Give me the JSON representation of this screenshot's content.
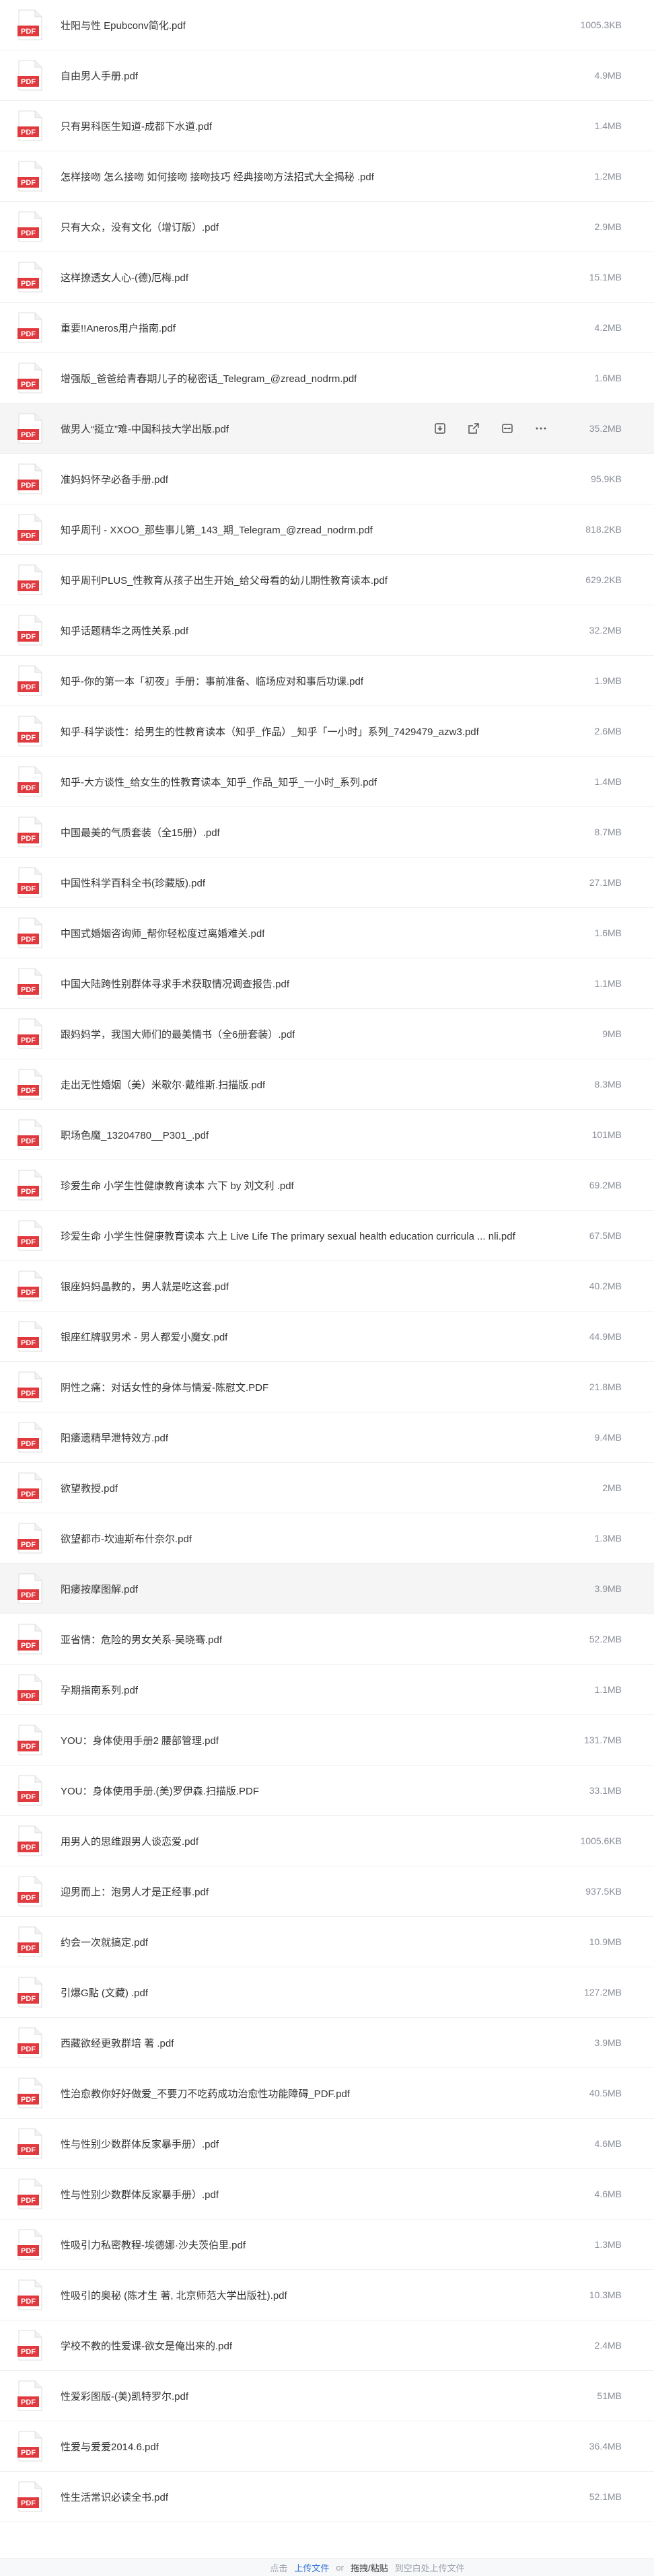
{
  "files": [
    {
      "name": "壮阳与性 Epubconv简化.pdf",
      "size": "1005.3KB"
    },
    {
      "name": "自由男人手册.pdf",
      "size": "4.9MB"
    },
    {
      "name": "只有男科医生知道-成都下水道.pdf",
      "size": "1.4MB"
    },
    {
      "name": "怎样接吻 怎么接吻 如何接吻 接吻技巧 经典接吻方法招式大全揭秘 .pdf",
      "size": "1.2MB"
    },
    {
      "name": "只有大众，没有文化（增订版）.pdf",
      "size": "2.9MB"
    },
    {
      "name": "这样撩透女人心-(德)厄梅.pdf",
      "size": "15.1MB"
    },
    {
      "name": "重要!!Aneros用户指南.pdf",
      "size": "4.2MB"
    },
    {
      "name": "增强版_爸爸给青春期儿子的秘密话_Telegram_@zread_nodrm.pdf",
      "size": "1.6MB"
    },
    {
      "name": "做男人“挺立”难-中国科技大学出版.pdf",
      "size": "35.2MB",
      "hover": true
    },
    {
      "name": "准妈妈怀孕必备手册.pdf",
      "size": "95.9KB"
    },
    {
      "name": "知乎周刊 - XXOO_那些事儿第_143_期_Telegram_@zread_nodrm.pdf",
      "size": "818.2KB"
    },
    {
      "name": "知乎周刊PLUS_性教育从孩子出生开始_给父母看的幼儿期性教育读本.pdf",
      "size": "629.2KB"
    },
    {
      "name": "知乎话题精华之两性关系.pdf",
      "size": "32.2MB"
    },
    {
      "name": "知乎-你的第一本「初夜」手册：事前准备、临场应对和事后功课.pdf",
      "size": "1.9MB"
    },
    {
      "name": "知乎-科学谈性：给男生的性教育读本（知乎_作品）_知乎「一小时」系列_7429479_azw3.pdf",
      "size": "2.6MB"
    },
    {
      "name": "知乎-大方谈性_给女生的性教育读本_知乎_作品_知乎_一小时_系列.pdf",
      "size": "1.4MB"
    },
    {
      "name": "中国最美的气质套装（全15册）.pdf",
      "size": "8.7MB"
    },
    {
      "name": "中国性科学百科全书(珍藏版).pdf",
      "size": "27.1MB"
    },
    {
      "name": "中国式婚姻咨询师_帮你轻松度过离婚难关.pdf",
      "size": "1.6MB"
    },
    {
      "name": "中国大陆跨性别群体寻求手术获取情况调查报告.pdf",
      "size": "1.1MB"
    },
    {
      "name": "跟妈妈学，我国大师们的最美情书（全6册套装）.pdf",
      "size": "9MB"
    },
    {
      "name": "走出无性婚姻（美）米歇尔·戴维斯.扫描版.pdf",
      "size": "8.3MB"
    },
    {
      "name": "职场色魔_13204780__P301_.pdf",
      "size": "101MB"
    },
    {
      "name": "珍爱生命 小学生性健康教育读本 六下 by 刘文利 .pdf",
      "size": "69.2MB"
    },
    {
      "name": "珍爱生命 小学生性健康教育读本 六上 Live Life The primary sexual health education curricula ... nli.pdf",
      "size": "67.5MB"
    },
    {
      "name": "银座妈妈晶教的，男人就是吃这套.pdf",
      "size": "40.2MB"
    },
    {
      "name": "银座红牌驭男术 - 男人都爱小魔女.pdf",
      "size": "44.9MB"
    },
    {
      "name": "阴性之痛：对话女性的身体与情爱-陈慰文.PDF",
      "size": "21.8MB"
    },
    {
      "name": "阳痿遗精早泄特效方.pdf",
      "size": "9.4MB"
    },
    {
      "name": "欲望教授.pdf",
      "size": "2MB"
    },
    {
      "name": "欲望都市-坎迪斯布什奈尔.pdf",
      "size": "1.3MB"
    },
    {
      "name": "阳痿按摩图解.pdf",
      "size": "3.9MB",
      "hover": true
    },
    {
      "name": "亚省情：危险的男女关系-吴晓骞.pdf",
      "size": "52.2MB"
    },
    {
      "name": "孕期指南系列.pdf",
      "size": "1.1MB"
    },
    {
      "name": "YOU：身体使用手册2 腰部管理.pdf",
      "size": "131.7MB"
    },
    {
      "name": "YOU：身体使用手册.(美)罗伊森.扫描版.PDF",
      "size": "33.1MB"
    },
    {
      "name": "用男人的思维跟男人谈恋爱.pdf",
      "size": "1005.6KB"
    },
    {
      "name": "迎男而上：泡男人才是正经事.pdf",
      "size": "937.5KB"
    },
    {
      "name": "约会一次就搞定.pdf",
      "size": "10.9MB"
    },
    {
      "name": "引爆G點 (文藏) .pdf",
      "size": "127.2MB"
    },
    {
      "name": "西藏欲经更敦群培 著 .pdf",
      "size": "3.9MB"
    },
    {
      "name": "性治愈教你好好做爱_不要刀不吃药成功治愈性功能障碍_PDF.pdf",
      "size": "40.5MB"
    },
    {
      "name": "性与性别少数群体反家暴手册）.pdf",
      "size": "4.6MB"
    },
    {
      "name": "性与性别少数群体反家暴手册）.pdf",
      "size": "4.6MB"
    },
    {
      "name": "性吸引力私密教程-埃德娜·沙夫茨伯里.pdf",
      "size": "1.3MB"
    },
    {
      "name": "性吸引的奥秘 (陈才生 著, 北京师范大学出版社).pdf",
      "size": "10.3MB"
    },
    {
      "name": "学校不教的性爱课-欲女是俺出来的.pdf",
      "size": "2.4MB"
    },
    {
      "name": "性爱彩图版-(美)凯特罗尔.pdf",
      "size": "51MB"
    },
    {
      "name": "性爱与爱爱2014.6.pdf",
      "size": "36.4MB"
    },
    {
      "name": "性生活常识必读全书.pdf",
      "size": "52.1MB"
    }
  ],
  "icon_label": "PDF",
  "footer": {
    "prefix": "点击",
    "upload_link": "上传文件",
    "or": "or",
    "drag_text": "拖拽/粘贴",
    "suffix": "到空白处上传文件"
  },
  "colors": {
    "icon_red": "#e0393e",
    "hover_bg": "#f5f5f5",
    "link": "#2f6fd6",
    "size_text": "#8a8f99"
  }
}
